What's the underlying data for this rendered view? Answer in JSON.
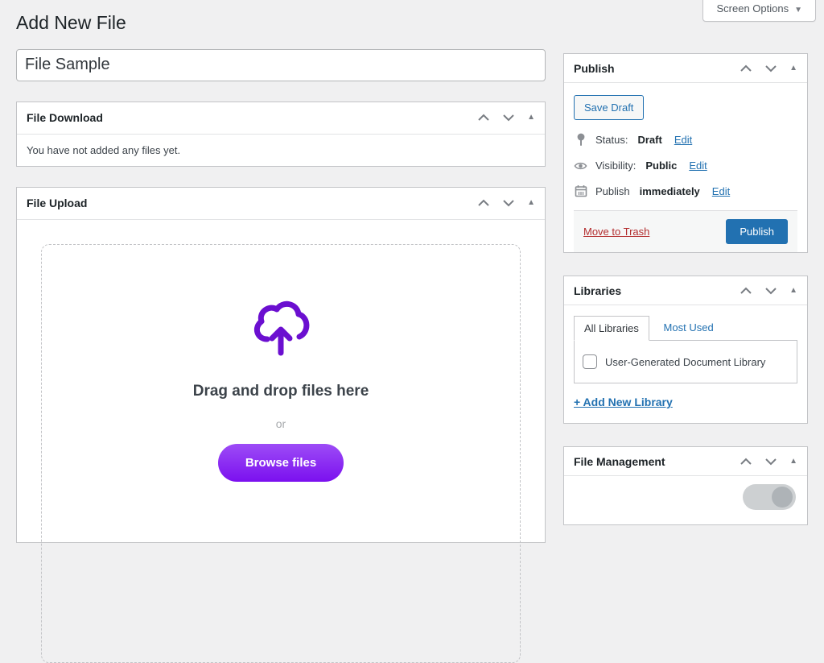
{
  "page": {
    "title": "Add New File"
  },
  "screen_options": {
    "label": "Screen Options",
    "caret": "▼"
  },
  "title_field": {
    "value": "File Sample"
  },
  "metabox_controls": {
    "move_up_icon": "chevron-up-icon",
    "move_down_icon": "chevron-down-icon",
    "toggle_icon": "collapse-triangle-icon",
    "toggle_glyph": "▲"
  },
  "file_download": {
    "title": "File Download",
    "empty_message": "You have not added any files yet."
  },
  "file_upload": {
    "title": "File Upload",
    "dropzone": {
      "icon": "cloud-upload-icon",
      "heading": "Drag and drop files here",
      "or_label": "or",
      "browse_label": "Browse files"
    }
  },
  "publish": {
    "title": "Publish",
    "save_draft_label": "Save Draft",
    "rows": [
      {
        "icon": "pin-icon",
        "label": "Status:",
        "value": "Draft",
        "edit": "Edit"
      },
      {
        "icon": "eye-icon",
        "label": "Visibility:",
        "value": "Public",
        "edit": "Edit"
      },
      {
        "icon": "calendar-icon",
        "label": "Publish",
        "value": "immediately",
        "edit": "Edit"
      }
    ],
    "move_to_trash_label": "Move to Trash",
    "publish_label": "Publish"
  },
  "libraries": {
    "title": "Libraries",
    "tabs": [
      {
        "label": "All Libraries",
        "active": true
      },
      {
        "label": "Most Used",
        "active": false
      }
    ],
    "items": [
      {
        "label": "User-Generated Document Library",
        "checked": false
      }
    ],
    "add_new_label": "+ Add New Library"
  },
  "file_management": {
    "title": "File Management"
  },
  "colors": {
    "accent_blue": "#2271b1",
    "trash_red": "#b32d2e",
    "upload_purple": "#6b0fd0",
    "browse_gradient_top": "#9d4cf6",
    "browse_gradient_bottom": "#7b10ef",
    "page_background": "#f0f0f1"
  }
}
